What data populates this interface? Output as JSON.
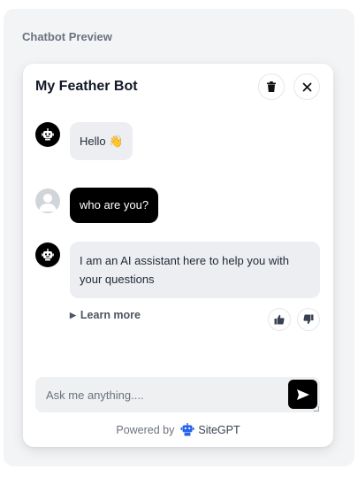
{
  "preview": {
    "title": "Chatbot Preview"
  },
  "chat": {
    "bot_name": "My Feather Bot",
    "messages": [
      {
        "role": "bot",
        "text": "Hello 👋"
      },
      {
        "role": "user",
        "text": "who are you?"
      },
      {
        "role": "bot",
        "text": "I am an AI assistant here to help you with your questions"
      }
    ],
    "learn_more": "Learn more",
    "input": {
      "placeholder": "Ask me anything....",
      "value": ""
    },
    "powered_by": {
      "prefix": "Powered by",
      "brand": "SiteGPT"
    }
  },
  "icons": {
    "delete": "trash-icon",
    "close": "close-icon",
    "bot_avatar": "robot-icon",
    "user_avatar": "user-icon",
    "thumbs_up": "thumbs-up-icon",
    "thumbs_down": "thumbs-down-icon",
    "send": "send-icon",
    "brand_logo": "sitegpt-logo-icon"
  },
  "colors": {
    "accent": "#000000",
    "brand": "#2563eb",
    "bot_bubble": "#eceef1",
    "user_bubble": "#000000",
    "panel": "#f3f4f6"
  }
}
